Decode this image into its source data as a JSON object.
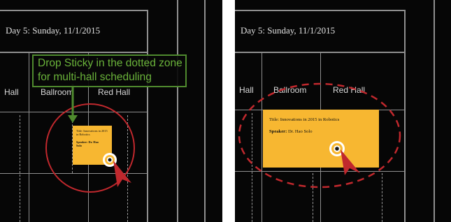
{
  "left_panel": {
    "day_title": "Day 5: Sunday, 11/1/2015",
    "halls": [
      "Hall",
      "Ballroom",
      "Red Hall"
    ],
    "tooltip": {
      "line1": "Drop Sticky in the dotted zone",
      "line2": "for multi-hall scheduling"
    },
    "sticky": {
      "title": "Title: Innovations in 2015 in Robotics",
      "speaker": "Speaker: Dr. Hao Solo"
    }
  },
  "right_panel": {
    "day_title": "Day 5: Sunday, 11/1/2015",
    "halls": [
      "Hall",
      "Ballroom",
      "Red Hall"
    ],
    "sticky": {
      "title_label": "Title:",
      "title_value": "Innovations in 2015 in Robotics",
      "speaker_label": "Speaker:",
      "speaker_value": "Dr. Hao Solo"
    }
  },
  "colors": {
    "sticky": "#f7b731",
    "highlight": "#c0282d",
    "tooltip_border": "#4f8a2e",
    "tooltip_text": "#6ab33a",
    "background": "#060606"
  },
  "icons": [
    "cursor-arrow-icon",
    "drag-target-icon",
    "down-arrow-icon"
  ]
}
